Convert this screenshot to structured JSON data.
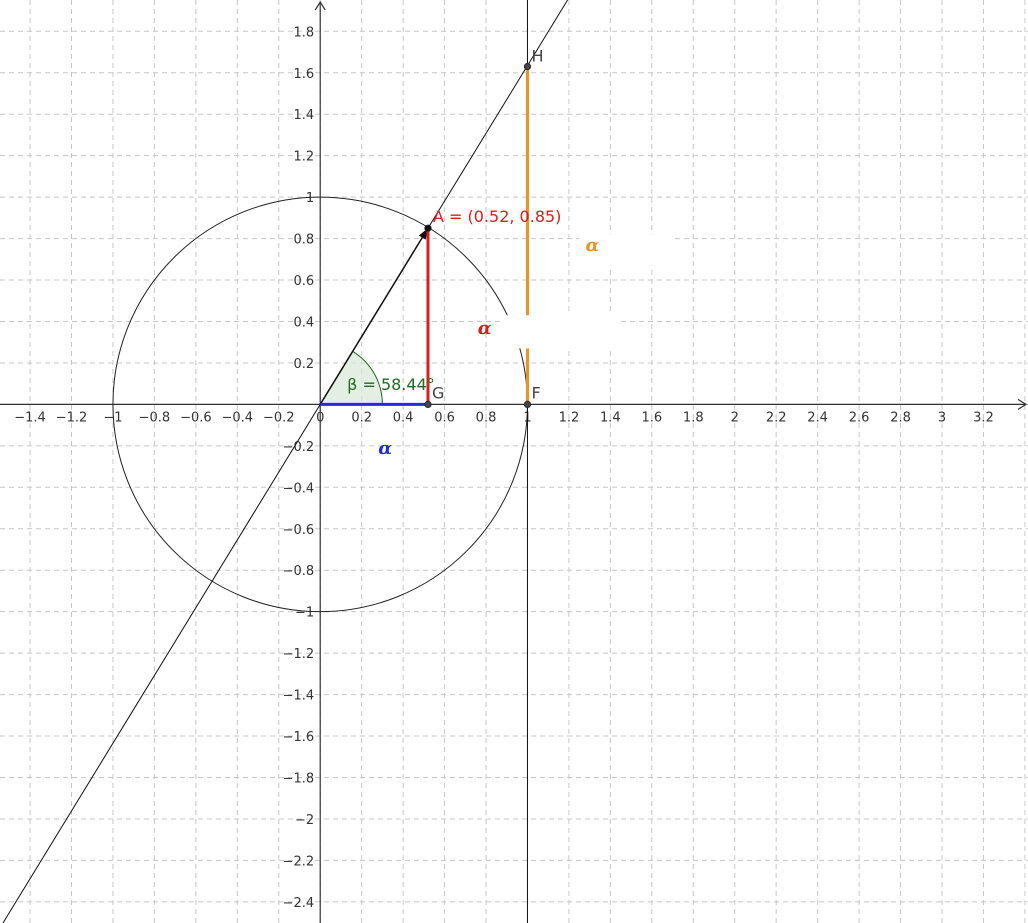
{
  "view": {
    "x_range": [
      -1.545,
      3.415
    ],
    "y_range": [
      -2.502,
      1.951
    ],
    "x_ticks": [
      "−1.4",
      "−1.2",
      "−1",
      "−0.8",
      "−0.6",
      "−0.4",
      "−0.2",
      "0",
      "0.2",
      "0.4",
      "0.6",
      "0.8",
      "1",
      "1.2",
      "1.4",
      "1.6",
      "1.8",
      "2",
      "2.2",
      "2.4",
      "2.6",
      "2.8",
      "3",
      "3.2"
    ],
    "y_ticks": [
      "1.8",
      "1.6",
      "1.4",
      "1.2",
      "1",
      "0.8",
      "0.6",
      "0.4",
      "0.2",
      "−0.2",
      "−0.4",
      "−0.6",
      "−0.8",
      "−1",
      "−1.2",
      "−1.4",
      "−1.6",
      "−1.8",
      "−2",
      "−2.2",
      "−2.4"
    ],
    "grid": true
  },
  "colors": {
    "axis": "#333333",
    "grid": "#c8c8c8",
    "circle": "#222222",
    "line": "#111111",
    "sine": "#e01b1b",
    "cosine": "#1c2fd9",
    "tangent": "#f0921e",
    "angle": "#1f6b1f",
    "angle_fill": "#d6e8d6"
  },
  "points": {
    "A": {
      "x": 0.52,
      "y": 0.85,
      "label": "A = (0.52, 0.85)"
    },
    "G": {
      "x": 0.52,
      "y": 0,
      "label": "G"
    },
    "F": {
      "x": 1,
      "y": 0,
      "label": "F"
    },
    "H": {
      "x": 1,
      "y": 1.63,
      "label": "H"
    }
  },
  "angle": {
    "degrees": 58.44,
    "label": "β = 58.44°"
  },
  "alpha_labels": {
    "sine": "α",
    "cosine": "α",
    "tangent": "α"
  }
}
